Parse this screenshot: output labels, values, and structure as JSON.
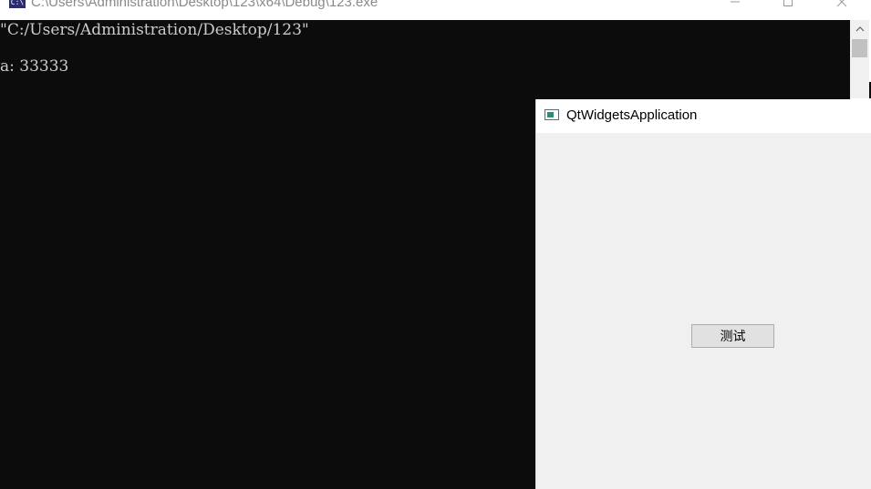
{
  "console_window": {
    "title": "C:\\Users\\Administration\\Desktop\\123\\x64\\Debug\\123.exe",
    "icon": "console-app-icon",
    "icon_text": "C:\\",
    "lines": [
      "\"C:/Users/Administration/Desktop/123\"",
      "a: 33333"
    ],
    "background_color": "#0c0c0c",
    "text_color": "#cccccc"
  },
  "qt_window": {
    "title": "QtWidgetsApplication",
    "icon": "qt-window-icon",
    "button_label": "测试",
    "background_color": "#f0f0f0"
  }
}
